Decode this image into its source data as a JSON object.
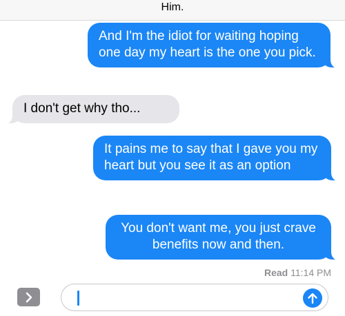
{
  "header": {
    "title": "Him."
  },
  "messages": [
    {
      "direction": "sent",
      "text": "And I'm the idiot for waiting hoping one day my heart is the one you pick."
    },
    {
      "direction": "received",
      "text": "I don't get why tho..."
    },
    {
      "direction": "sent",
      "text": "It pains me to say that I gave you my heart but you see it as an option"
    },
    {
      "direction": "sent",
      "text": "You don't want me, you just crave benefits now and then."
    }
  ],
  "receipt": {
    "label": "Read",
    "time": "11:14 PM"
  },
  "composer": {
    "expand_icon": "chevron-right-icon",
    "send_icon": "arrow-up-icon"
  },
  "colors": {
    "sent_bubble": "#1b86f5",
    "received_bubble": "#e5e5ea",
    "header_bg": "#f7f7f7"
  }
}
